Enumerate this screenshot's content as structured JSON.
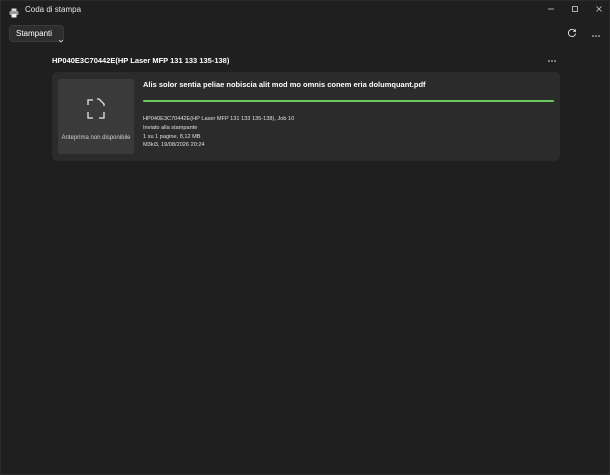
{
  "window": {
    "title": "Coda di stampa"
  },
  "toolbar": {
    "printers_label": "Stampanti"
  },
  "printer": {
    "name": "HP040E3C70442E(HP Laser MFP 131 133 135-138)"
  },
  "job": {
    "document_title": "Alis solor sentia peliae nobiscia alit mod mo omnis conem eria dolumquant.pdf",
    "preview_label": "Anteprima non disponibile",
    "progress": 1.0,
    "info_lines": [
      "HP040E3C70442E(HP Laser MFP 131 133 135-138), Job 10",
      "Inviato alla stampante",
      "1 su 1 pagine, 8,12 MB",
      "M3ki3, 19/08/2026 20:24"
    ]
  },
  "colors": {
    "accent_progress": "#6ccb5f",
    "background": "#1f1f1f",
    "card": "#2b2b2b"
  },
  "icons": {
    "app": "printer-icon",
    "refresh": "refresh-icon",
    "more": "more-icon",
    "chevron": "chevron-down-icon",
    "preview": "document-placeholder-icon"
  }
}
